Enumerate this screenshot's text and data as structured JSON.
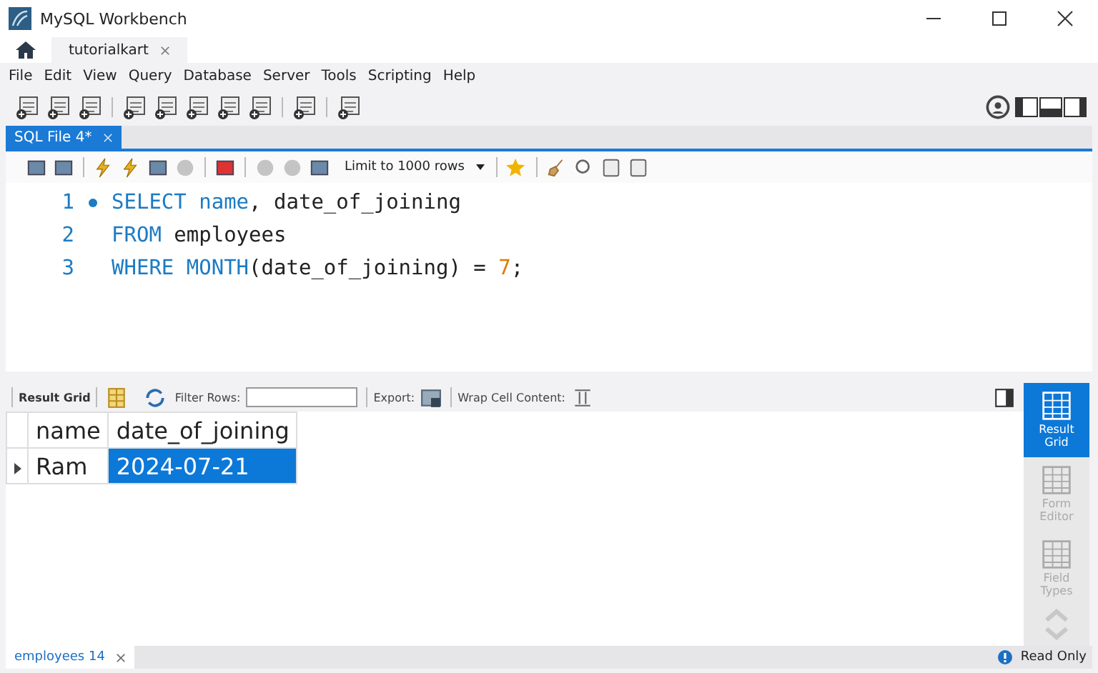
{
  "window": {
    "title": "MySQL Workbench"
  },
  "connection_tabs": [
    {
      "label": "tutorialkart",
      "selected": true
    }
  ],
  "menu": [
    "File",
    "Edit",
    "View",
    "Query",
    "Database",
    "Server",
    "Tools",
    "Scripting",
    "Help"
  ],
  "query_tabs": [
    {
      "label": "SQL File 4*",
      "selected": true
    }
  ],
  "editor_toolbar": {
    "limit": "Limit to 1000 rows"
  },
  "editor": {
    "lines": [
      {
        "number": "1",
        "current": true,
        "tokens": [
          {
            "kind": "keyword",
            "text": "SELECT"
          },
          {
            "kind": "keyword",
            "text": " name"
          },
          {
            "kind": "plain",
            "text": ", date_of_joining"
          }
        ]
      },
      {
        "number": "2",
        "current": false,
        "tokens": [
          {
            "kind": "keyword",
            "text": "FROM"
          },
          {
            "kind": "plain",
            "text": " employees"
          }
        ]
      },
      {
        "number": "3",
        "current": false,
        "tokens": [
          {
            "kind": "keyword",
            "text": "WHERE"
          },
          {
            "kind": "keyword",
            "text": " MONTH"
          },
          {
            "kind": "plain",
            "text": "(date_of_joining) = "
          },
          {
            "kind": "number",
            "text": "7"
          },
          {
            "kind": "plain",
            "text": ";"
          }
        ]
      }
    ]
  },
  "results": {
    "toolbar": {
      "result_grid": "Result Grid",
      "filter_label": "Filter Rows:",
      "export_label": "Export:",
      "wrap_label": "Wrap Cell Content:"
    },
    "columns": [
      "name",
      "date_of_joining"
    ],
    "rows": [
      {
        "current": true,
        "cells": [
          {
            "text": "Ram",
            "selected": false
          },
          {
            "text": "2024-07-21",
            "selected": true
          }
        ]
      }
    ]
  },
  "side_panel": [
    {
      "label": "Result Grid",
      "selected": true,
      "disabled": false
    },
    {
      "label": "Form Editor",
      "selected": false,
      "disabled": true
    },
    {
      "label": "Field Types",
      "selected": false,
      "disabled": true
    }
  ],
  "result_tabs": [
    {
      "label": "employees 14",
      "selected": true
    }
  ],
  "status": "Read Only"
}
